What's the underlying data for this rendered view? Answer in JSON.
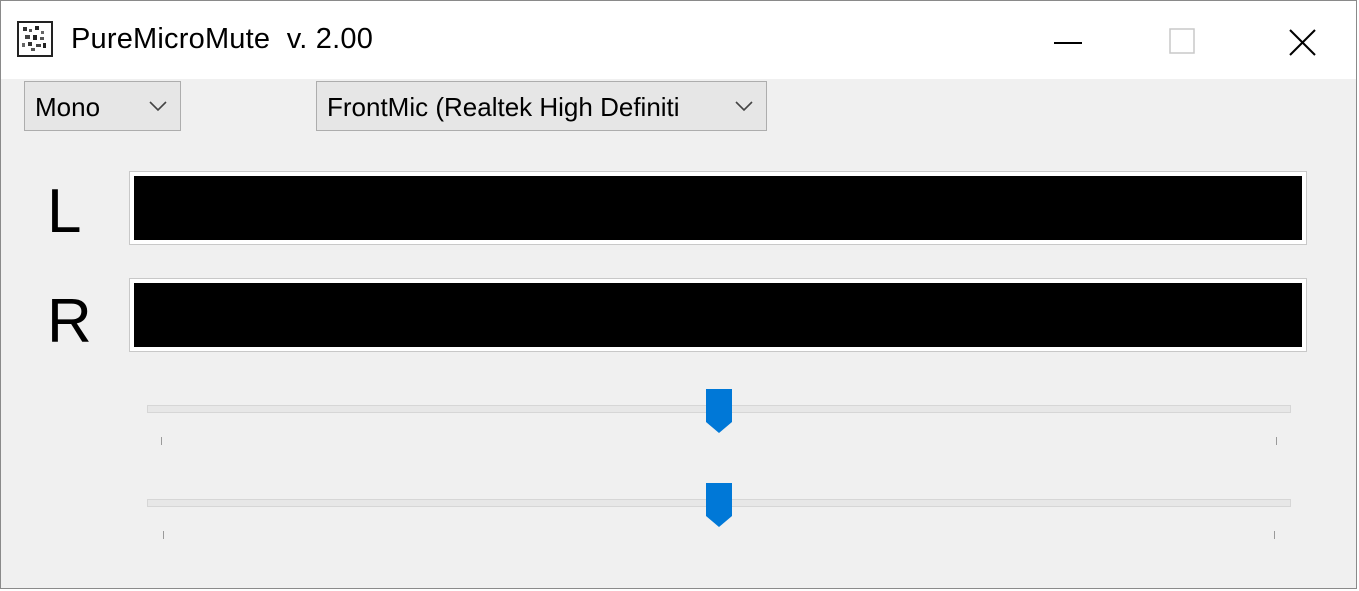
{
  "window": {
    "title": "PureMicroMute  v. 2.00",
    "icon": "app-icon",
    "controls": [
      "minimize-icon",
      "maximize-icon",
      "close-icon"
    ]
  },
  "toolbar": {
    "mode_select": {
      "value": "Mono",
      "icon": "chevron-down-icon"
    },
    "device_select": {
      "value": "FrontMic (Realtek High Definiti",
      "icon": "chevron-down-icon"
    }
  },
  "meters": {
    "left": {
      "label": "L",
      "level": 0
    },
    "right": {
      "label": "R",
      "level": 0
    }
  },
  "sliders": [
    {
      "name": "slider-1",
      "value": 0.5
    },
    {
      "name": "slider-2",
      "value": 0.5
    }
  ],
  "colors": {
    "accent": "#0078d7",
    "meter_background": "#000000",
    "window_background": "#f0f0f0"
  }
}
